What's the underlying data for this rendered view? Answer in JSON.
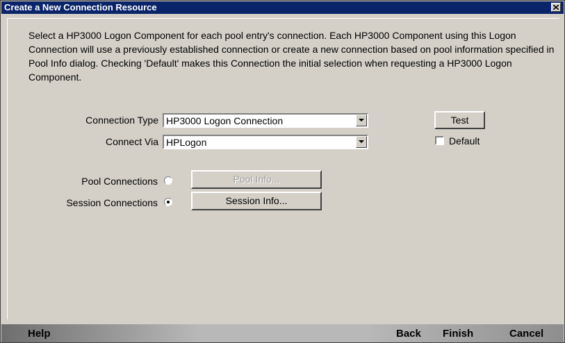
{
  "window": {
    "title": "Create a New Connection Resource"
  },
  "description": "Select a HP3000 Logon Component for each pool entry's connection. Each HP3000 Component using this Logon Connection will use a previously established connection or create a new connection based on pool information specified in Pool Info dialog. Checking 'Default' makes this Connection the initial selection when requesting a HP3000 Logon Component.",
  "form": {
    "connection_type": {
      "label": "Connection Type",
      "value": "HP3000 Logon Connection"
    },
    "connect_via": {
      "label": "Connect Via",
      "value": "HPLogon"
    },
    "test_label": "Test",
    "default_label": "Default",
    "default_checked": false,
    "pool_connections": {
      "label": "Pool Connections",
      "selected": false,
      "button": "Pool Info...",
      "button_enabled": false
    },
    "session_connections": {
      "label": "Session Connections",
      "selected": true,
      "button": "Session Info...",
      "button_enabled": true
    }
  },
  "nav": {
    "help": "Help",
    "back": "Back",
    "finish": "Finish",
    "cancel": "Cancel"
  }
}
